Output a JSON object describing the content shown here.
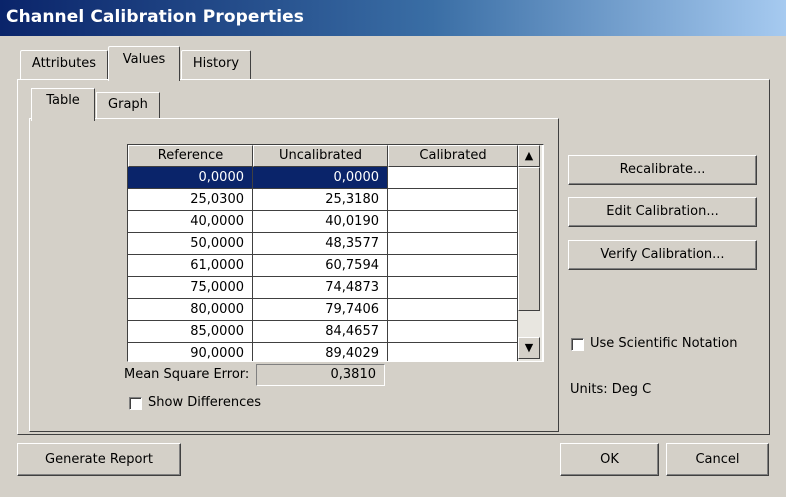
{
  "window": {
    "title": "Channel Calibration Properties"
  },
  "tabs": [
    {
      "label": "Attributes",
      "active": false
    },
    {
      "label": "Values",
      "active": true
    },
    {
      "label": "History",
      "active": false
    }
  ],
  "inner_tabs": [
    {
      "label": "Table",
      "active": true
    },
    {
      "label": "Graph",
      "active": false
    }
  ],
  "table": {
    "columns": [
      "Reference",
      "Uncalibrated",
      "Calibrated"
    ],
    "rows": [
      [
        "0,0000",
        "0,0000",
        ""
      ],
      [
        "25,0300",
        "25,3180",
        ""
      ],
      [
        "40,0000",
        "40,0190",
        ""
      ],
      [
        "50,0000",
        "48,3577",
        ""
      ],
      [
        "61,0000",
        "60,7594",
        ""
      ],
      [
        "75,0000",
        "74,4873",
        ""
      ],
      [
        "80,0000",
        "79,7406",
        ""
      ],
      [
        "85,0000",
        "84,4657",
        ""
      ],
      [
        "90,0000",
        "89,4029",
        ""
      ]
    ],
    "selected_row": 0,
    "scroll_up_icon": "triangle-up-icon",
    "scroll_down_icon": "triangle-down-icon"
  },
  "mean_square_error": {
    "label": "Mean Square Error:",
    "value": "0,3810"
  },
  "show_differences": {
    "label": "Show Differences",
    "checked": false
  },
  "side_buttons": {
    "recalibrate": "Recalibrate...",
    "edit_calibration": "Edit Calibration...",
    "verify_calibration": "Verify Calibration..."
  },
  "scientific_notation": {
    "label": "Use Scientific Notation",
    "checked": false
  },
  "units": {
    "text": "Units: Deg C"
  },
  "footer": {
    "generate_report": "Generate Report",
    "ok": "OK",
    "cancel": "Cancel"
  },
  "colors": {
    "title_bar_start": "#0a246a",
    "title_bar_end": "#a6caf0",
    "selection": "#0a246a",
    "dialog_face": "#d4d0c8"
  }
}
